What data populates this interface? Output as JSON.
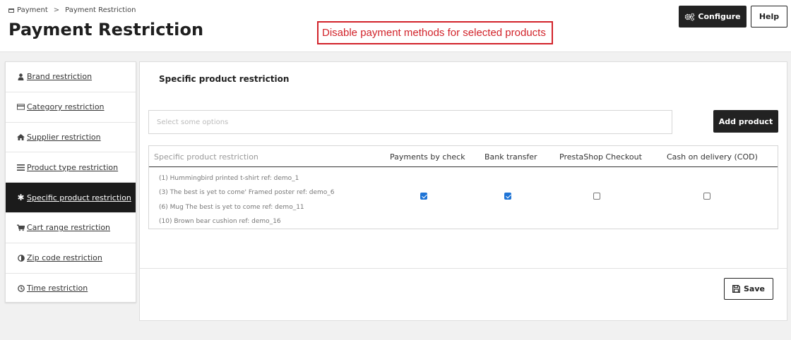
{
  "breadcrumb": {
    "parent": "Payment",
    "separator": ">",
    "current": "Payment Restriction"
  },
  "page_title": "Payment Restriction",
  "annotation": "Disable payment methods for selected products",
  "header_buttons": {
    "configure": "Configure",
    "help": "Help"
  },
  "sidebar": {
    "items": [
      {
        "label": "Brand restriction",
        "icon": "user-icon",
        "active": false
      },
      {
        "label": "Category restriction",
        "icon": "credit-card-icon",
        "active": false
      },
      {
        "label": "Supplier restriction",
        "icon": "home-icon",
        "active": false
      },
      {
        "label": "Product type restriction",
        "icon": "list-icon",
        "active": false
      },
      {
        "label": "Specific product restriction",
        "icon": "asterisk-icon",
        "active": true
      },
      {
        "label": "Cart range restriction",
        "icon": "cart-icon",
        "active": false
      },
      {
        "label": "Zip code restriction",
        "icon": "contrast-icon",
        "active": false
      },
      {
        "label": "Time restriction",
        "icon": "clock-icon",
        "active": false
      }
    ]
  },
  "panel": {
    "title": "Specific product restriction",
    "select_placeholder": "Select some options",
    "add_button": "Add product",
    "table": {
      "headers": [
        "Specific product restriction",
        "Payments by check",
        "Bank transfer",
        "PrestaShop Checkout",
        "Cash on delivery (COD)"
      ],
      "products": [
        "(1) Hummingbird printed t-shirt ref: demo_1",
        "(3) The best is yet to come' Framed poster ref: demo_6",
        "(6) Mug The best is yet to come ref: demo_11",
        "(10) Brown bear cushion ref: demo_16"
      ],
      "checked": [
        true,
        true,
        false,
        false
      ]
    },
    "save_button": "Save"
  }
}
